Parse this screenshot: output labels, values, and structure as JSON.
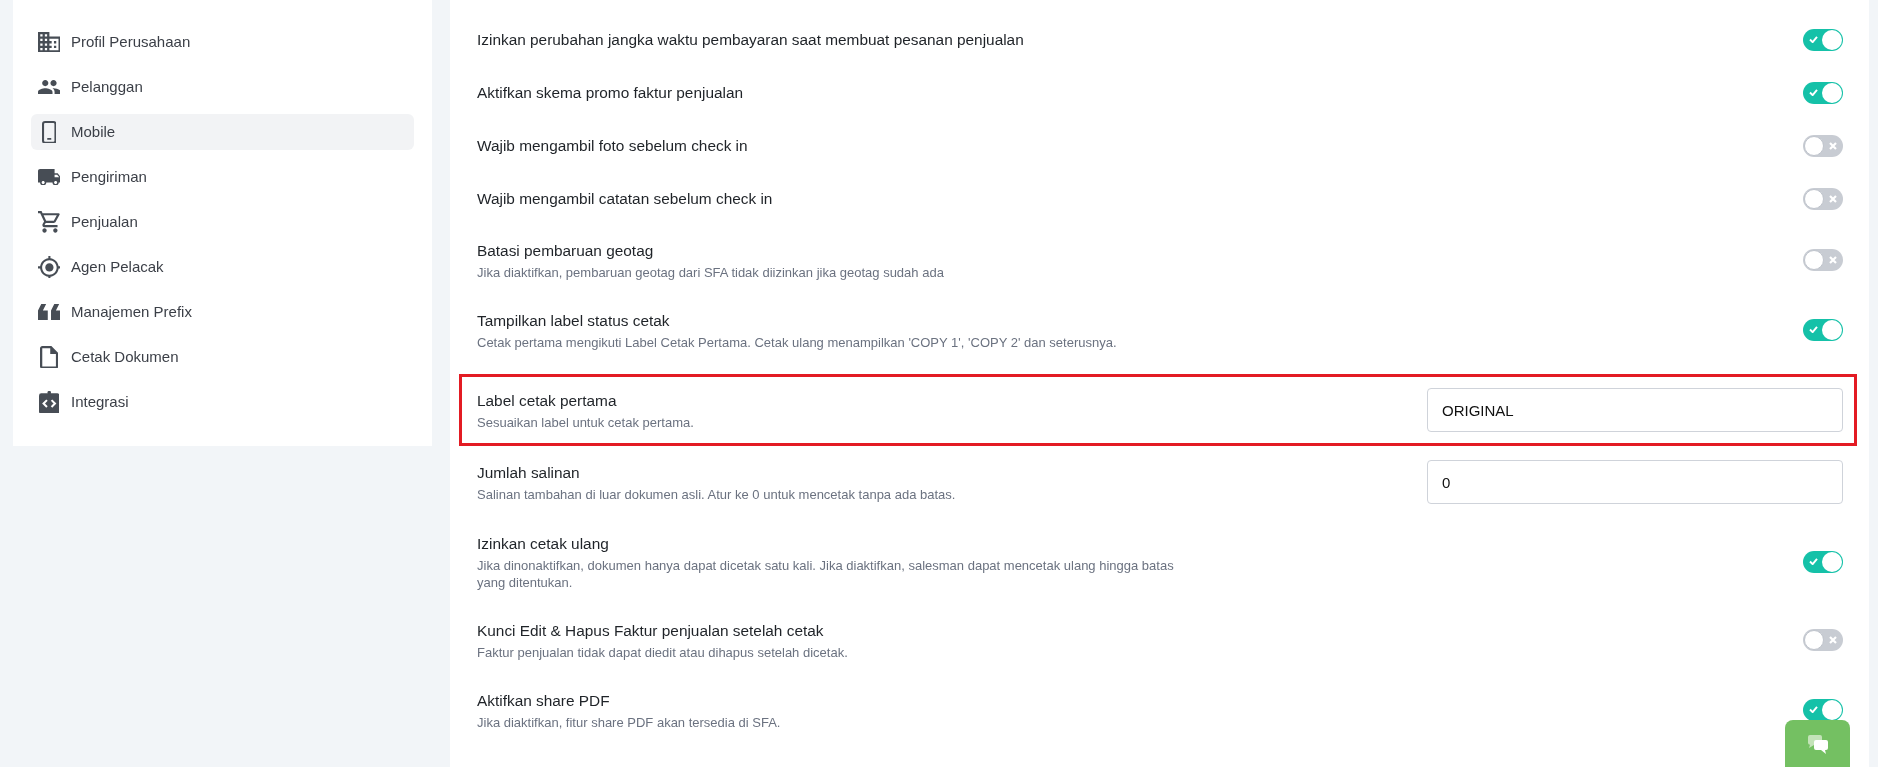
{
  "sidebar": {
    "items": [
      {
        "label": "Profil Perusahaan",
        "selected": false
      },
      {
        "label": "Pelanggan",
        "selected": false
      },
      {
        "label": "Mobile",
        "selected": true
      },
      {
        "label": "Pengiriman",
        "selected": false
      },
      {
        "label": "Penjualan",
        "selected": false
      },
      {
        "label": "Agen Pelacak",
        "selected": false
      },
      {
        "label": "Manajemen Prefix",
        "selected": false
      },
      {
        "label": "Cetak Dokumen",
        "selected": false
      },
      {
        "label": "Integrasi",
        "selected": false
      }
    ]
  },
  "settings": {
    "rows": [
      {
        "kind": "toggle",
        "title": "Izinkan perubahan jangka waktu pembayaran saat membuat pesanan penjualan",
        "on": true,
        "highlighted": false
      },
      {
        "kind": "toggle",
        "title": "Aktifkan skema promo faktur penjualan",
        "on": true,
        "highlighted": false
      },
      {
        "kind": "toggle",
        "title": "Wajib mengambil foto sebelum check in",
        "on": false,
        "highlighted": false
      },
      {
        "kind": "toggle",
        "title": "Wajib mengambil catatan sebelum check in",
        "on": false,
        "highlighted": false
      },
      {
        "kind": "toggle",
        "title": "Batasi pembaruan geotag",
        "description": "Jika diaktifkan, pembaruan geotag dari SFA tidak diizinkan jika geotag sudah ada",
        "on": false,
        "highlighted": false
      },
      {
        "kind": "toggle",
        "title": "Tampilkan label status cetak",
        "description": "Cetak pertama mengikuti Label Cetak Pertama. Cetak ulang menampilkan 'COPY 1', 'COPY 2' dan seterusnya.",
        "on": true,
        "highlighted": false
      },
      {
        "kind": "text",
        "title": "Label cetak pertama",
        "description": "Sesuaikan label untuk cetak pertama.",
        "value": "ORIGINAL",
        "highlighted": true
      },
      {
        "kind": "text",
        "title": "Jumlah salinan",
        "description": "Salinan tambahan di luar dokumen asli. Atur ke 0 untuk mencetak tanpa ada batas.",
        "value": "0",
        "highlighted": false
      },
      {
        "kind": "toggle",
        "title": "Izinkan cetak ulang",
        "description": "Jika dinonaktifkan, dokumen hanya dapat dicetak satu kali. Jika diaktifkan, salesman dapat mencetak ulang hingga batas yang ditentukan.",
        "on": true,
        "highlighted": false
      },
      {
        "kind": "toggle",
        "title": "Kunci Edit & Hapus Faktur penjualan setelah cetak",
        "description": "Faktur penjualan tidak dapat diedit atau dihapus setelah dicetak.",
        "on": false,
        "highlighted": false
      },
      {
        "kind": "toggle",
        "title": "Aktifkan share PDF",
        "description": "Jika diaktifkan, fitur share PDF akan tersedia di SFA.",
        "on": true,
        "highlighted": false
      }
    ]
  }
}
